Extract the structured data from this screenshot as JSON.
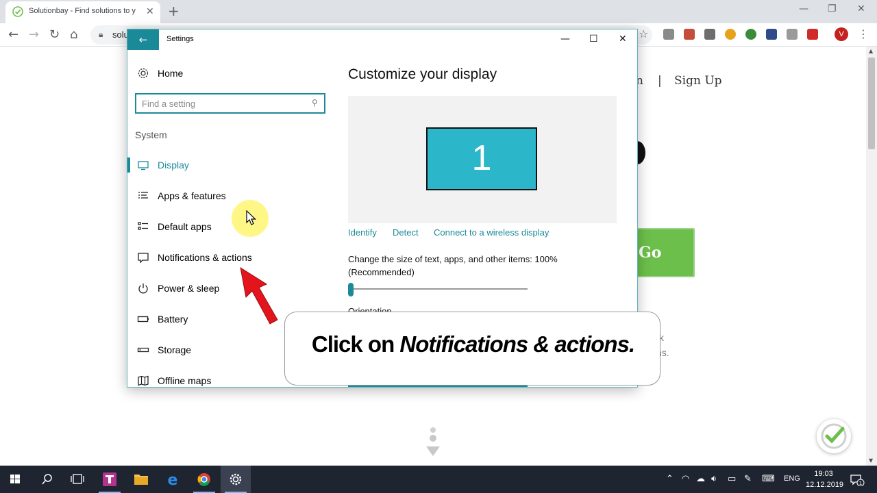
{
  "browser": {
    "tab_title": "Solutionbay - Find solutions to y",
    "url": "solu",
    "profile_initial": "V"
  },
  "website": {
    "nav_login_partial": "n",
    "nav_separator": "|",
    "nav_signup": "Sign Up",
    "go_button": "Go",
    "text_fragment_1": "k",
    "text_fragment_2": "ns."
  },
  "settings": {
    "window_title": "Settings",
    "home_label": "Home",
    "search_placeholder": "Find a setting",
    "section_label": "System",
    "nav_items": [
      {
        "label": "Display",
        "icon": "display-icon",
        "active": true
      },
      {
        "label": "Apps & features",
        "icon": "apps-features-icon",
        "active": false
      },
      {
        "label": "Default apps",
        "icon": "default-apps-icon",
        "active": false
      },
      {
        "label": "Notifications & actions",
        "icon": "notifications-icon",
        "active": false
      },
      {
        "label": "Power & sleep",
        "icon": "power-icon",
        "active": false
      },
      {
        "label": "Battery",
        "icon": "battery-icon",
        "active": false
      },
      {
        "label": "Storage",
        "icon": "storage-icon",
        "active": false
      },
      {
        "label": "Offline maps",
        "icon": "map-icon",
        "active": false
      }
    ],
    "content": {
      "title": "Customize your display",
      "monitor_number": "1",
      "link_identify": "Identify",
      "link_detect": "Detect",
      "link_wireless": "Connect to a wireless display",
      "size_label": "Change the size of text, apps, and other items: 100% (Recommended)",
      "orientation_label": "Orientation"
    }
  },
  "callout": {
    "prefix": "Click on",
    "emphasis": "Notifications & actions."
  },
  "taskbar": {
    "language": "ENG",
    "time": "19:03",
    "date": "12.12.2019",
    "notification_count": "1"
  },
  "colors": {
    "accent": "#1b8a98",
    "monitor": "#2bb6c9",
    "go_button": "#6cbf4a",
    "taskbar": "#1e2430"
  }
}
